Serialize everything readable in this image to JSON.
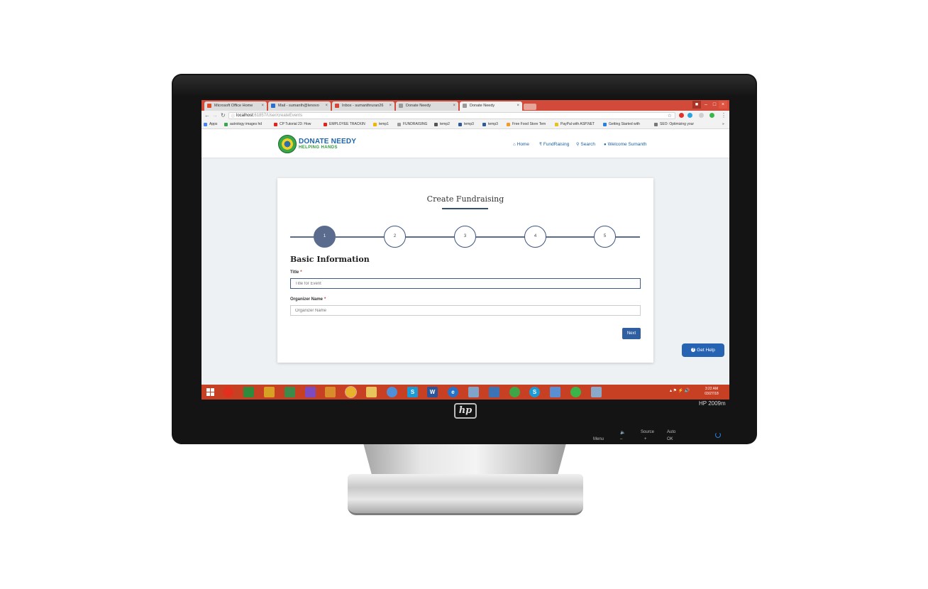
{
  "browser": {
    "tabs": [
      {
        "title": "Microsoft Office Home",
        "favicon_color": "#e04d2d"
      },
      {
        "title": "Mail - sumanth@lenovo",
        "favicon_color": "#2a6fc9"
      },
      {
        "title": "Inbox - sumanthruran26",
        "favicon_color": "#d44638"
      },
      {
        "title": "Donate Needy",
        "favicon_color": "#9a9a9a"
      },
      {
        "title": "Donate Needy",
        "favicon_color": "#9a9a9a"
      }
    ],
    "url_host": "localhost:",
    "url_path": "61857/User/createEvents",
    "bookmarks": [
      {
        "label": "Apps",
        "color": "#4285f4"
      },
      {
        "label": "autrology images hd",
        "color": "#34a853"
      },
      {
        "label": "CP Tutorial 23: How",
        "color": "#e62117"
      },
      {
        "label": "EMPLOYEE TRACKIN",
        "color": "#e62117"
      },
      {
        "label": "temp1",
        "color": "#f4b400"
      },
      {
        "label": "FUNDRAISING",
        "color": "#9a9a9a"
      },
      {
        "label": "temp2",
        "color": "#555555"
      },
      {
        "label": "temp3",
        "color": "#2d5c9a"
      },
      {
        "label": "temp3",
        "color": "#2d5c9a"
      },
      {
        "label": "Free Food Store Tem",
        "color": "#f49b25"
      },
      {
        "label": "PayPal with ASP.NET",
        "color": "#e8c11c"
      },
      {
        "label": "Getting Started with",
        "color": "#2a7de1"
      },
      {
        "label": "SEO: Optimizing your",
        "color": "#777777"
      }
    ]
  },
  "site": {
    "brand_title": "DONATE NEEDY",
    "brand_sub": "HELPING HANDS",
    "nav": {
      "home": "Home",
      "fundraising": "FundRaising",
      "search": "Search",
      "welcome": "Welcome Sumanth"
    }
  },
  "form": {
    "title": "Create Fundraising",
    "steps": [
      "1",
      "2",
      "3",
      "4",
      "5"
    ],
    "active_step": 1,
    "section": "Basic Information",
    "fields": {
      "title_label": "Title",
      "title_placeholder": "Title for Event",
      "organizer_label": "Organizer Name",
      "organizer_placeholder": "Organizer Name",
      "required_mark": "*"
    },
    "next_label": "Next"
  },
  "help": {
    "label": "Get Help"
  },
  "taskbar": {
    "time": "3:22 AM",
    "date": "03/27/18"
  },
  "monitor": {
    "model": "HP 2009m",
    "brand": "hp",
    "controls": {
      "menu": "Menu",
      "source": "Source",
      "auto": "Auto",
      "minus": "–",
      "plus": "+",
      "ok": "OK"
    }
  },
  "colors": {
    "accent": "#2f5fa0",
    "taskbar": "#c84024",
    "step_active": "#5a6b8d",
    "brand_blue": "#1e63b0",
    "brand_green": "#2e9a3b"
  }
}
